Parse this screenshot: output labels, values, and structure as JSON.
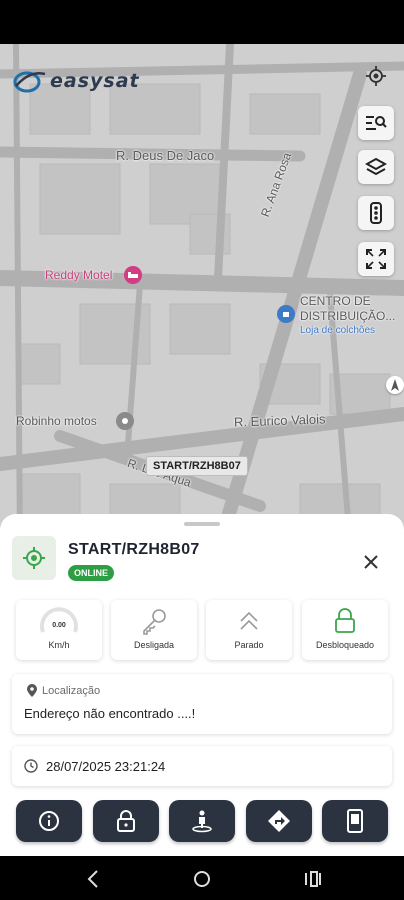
{
  "app": {
    "logo_text": "easysat"
  },
  "map": {
    "streets": [
      {
        "id": "deus",
        "label": "R. Deus De Jaco"
      },
      {
        "id": "ana",
        "label": "R. Ana Rosa"
      },
      {
        "id": "eurico",
        "label": "R. Eurico Valois"
      },
      {
        "id": "leo",
        "label": "R. Léo Aqua"
      }
    ],
    "pois": [
      {
        "id": "reddy",
        "label": "Reddy Motel",
        "color": "#d23c84"
      },
      {
        "id": "centro_title_1",
        "label": "CENTRO DE"
      },
      {
        "id": "centro_title_2",
        "label": "DISTRIBUIÇÃO..."
      },
      {
        "id": "centro_sub",
        "label": "Loja de colchões",
        "color": "#3f7ac7"
      },
      {
        "id": "robinho",
        "label": "Robinho motos"
      }
    ],
    "vehicle_tag": "START/RZH8B07",
    "controls": [
      "locate-icon",
      "search-list-icon",
      "layers-icon",
      "traffic-light-icon",
      "fullscreen-icon"
    ]
  },
  "vehicle": {
    "name": "START/RZH8B07",
    "status": "ONLINE",
    "status_color": "#2e9e44",
    "stats": {
      "speed_value": "0.00",
      "speed_unit": "Km/h",
      "ignition": "Desligada",
      "movement": "Parado",
      "lock": "Desbloqueado"
    },
    "location": {
      "title": "Localização",
      "address": "Endereço não encontrado ....!"
    },
    "timestamp": "28/07/2025 23:21:24"
  },
  "actions": [
    "info-icon",
    "lock-icon",
    "person-location-icon",
    "directions-icon",
    "phone-icon"
  ],
  "colors": {
    "action_bg": "#2c3340",
    "accent_green": "#2e9e44"
  }
}
